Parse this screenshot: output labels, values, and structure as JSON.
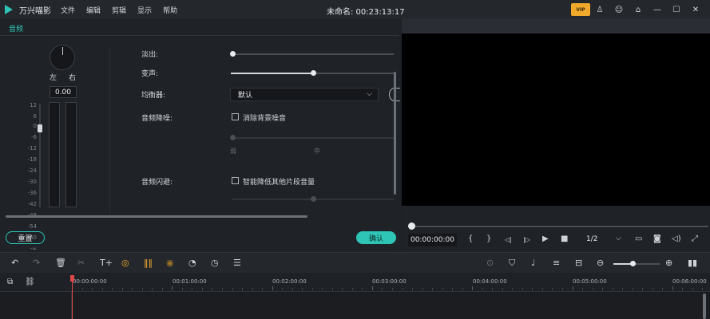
{
  "titlebar": {
    "app_name": "万兴喵影",
    "menus": [
      "文件",
      "编辑",
      "剪辑",
      "显示",
      "帮助"
    ],
    "window_title": "未命名: 00:23:13:17",
    "vip_label": "VIP",
    "controls": {
      "account": "♙",
      "feedback": "☺",
      "store": "⌂",
      "minimize": "—",
      "maximize": "☐",
      "close": "✕"
    }
  },
  "audio_panel": {
    "tab": "音频",
    "balance_left": "左",
    "balance_right": "右",
    "balance_value": "0.00",
    "scale": [
      "12",
      "6",
      "0",
      "-6",
      "-12",
      "-18",
      "-24",
      "-30",
      "-36",
      "-42",
      "-48",
      "-54",
      "-60",
      "-∞"
    ],
    "volume_level": 0.24,
    "fields": {
      "fade_out": {
        "label": "淡出:",
        "value": 0.0
      },
      "voice_change": {
        "label": "变声:",
        "value": 0.5
      },
      "equalizer": {
        "label": "均衡器:",
        "selected": "默认"
      },
      "denoise": {
        "label": "音频降噪:",
        "checkbox": "消除背景噪音",
        "checked": false,
        "low": "弱",
        "mid": "中"
      },
      "ducking": {
        "label": "音频闪避:",
        "checkbox": "智能降低其他片段音量",
        "checked": false
      }
    },
    "reset_button": "重置",
    "ok_button": "确认"
  },
  "preview": {
    "timecode": "00:00:00:00",
    "progress": 0.0,
    "speed": "1/2"
  },
  "toolbar": {
    "zoom_level": 0.42
  },
  "timeline": {
    "ruler_labels": [
      "00:00:00:00",
      "00:01:00:00",
      "00:02:00:00",
      "00:03:00:00",
      "00:04:00:00",
      "00:05:00:00",
      "00:06:00:00"
    ]
  },
  "colors": {
    "accent": "#2ec4b6",
    "playhead": "#e04848",
    "vip": "#f0a92b"
  }
}
